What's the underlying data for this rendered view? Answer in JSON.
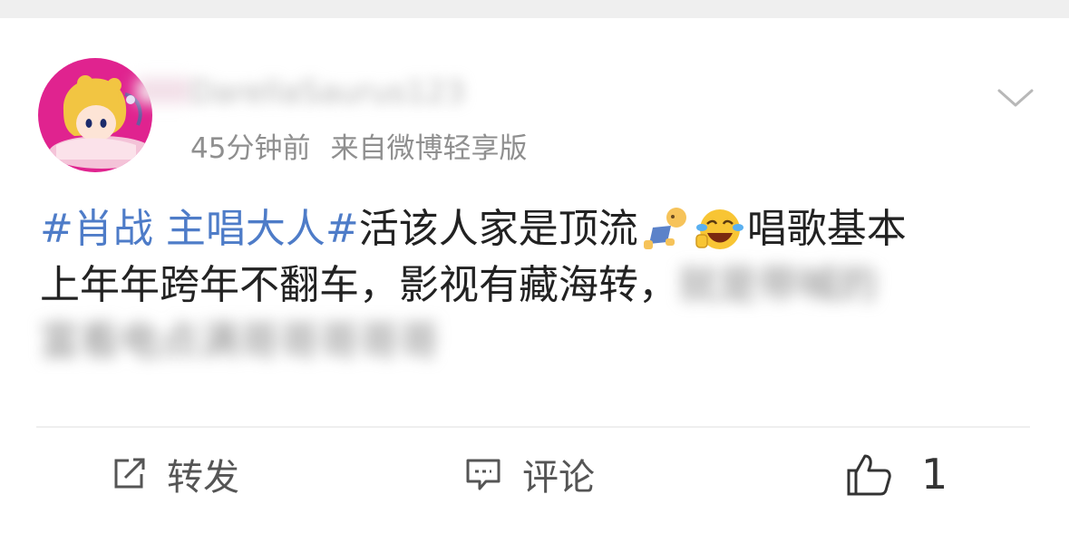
{
  "post": {
    "author": {
      "username_masked": "DarellaSaurus123"
    },
    "time": "45分钟前",
    "source": "来自微博轻享版",
    "content": {
      "topic": "#肖战 主唱大人#",
      "text_line1": "活该人家是顶流",
      "text_line1_end": "唱歌基本",
      "text_line2": "上年年跨年不翻车，影视有藏海转，",
      "text_line2_blurred": "就是带喊的",
      "text_line3_blurred": "富看电点满哥哥哥哥哥",
      "emojis": [
        "baby-bottle-emoji",
        "laughing-crying-emoji"
      ]
    },
    "actions": {
      "repost_label": "转发",
      "comment_label": "评论",
      "like_count": "1"
    }
  },
  "colors": {
    "topic": "#4e7cc8",
    "avatar_bg": "#e0238f",
    "meta": "#8f8f8f"
  }
}
